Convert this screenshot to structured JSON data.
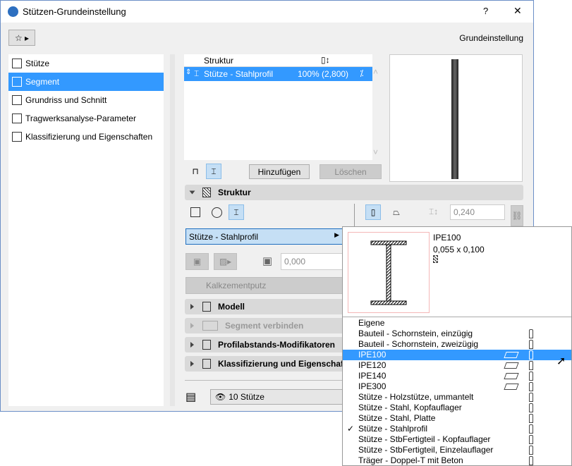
{
  "window": {
    "title": "Stützen-Grundeinstellung",
    "help": "?",
    "close": "✕",
    "preset_label": "Grundeinstellung"
  },
  "sidebar": {
    "items": [
      {
        "label": "Stütze",
        "icon": "column-icon"
      },
      {
        "label": "Segment",
        "icon": "segment-icon",
        "selected": true
      },
      {
        "label": "Grundriss und Schnitt",
        "icon": "floorplan-icon"
      },
      {
        "label": "Tragwerksanalyse-Parameter",
        "icon": "structural-analysis-icon"
      },
      {
        "label": "Klassifizierung und Eigenschaften",
        "icon": "document-icon"
      }
    ]
  },
  "segments_table": {
    "header": "Struktur",
    "header_height_icon": "height-icon",
    "row": {
      "name": "Stütze - Stahlprofil",
      "value": "100% (2,800)"
    }
  },
  "buttons": {
    "add": "Hinzufügen",
    "delete": "Löschen"
  },
  "struktur": {
    "title": "Struktur",
    "profile": "Stütze - Stahlprofil",
    "offset": "0,000",
    "material": "Kalkzementputz",
    "thickness": "0,240"
  },
  "sections": [
    {
      "label": "Modell",
      "disabled": false
    },
    {
      "label": "Segment verbinden",
      "disabled": true
    },
    {
      "label": "Profilabstands-Modifikatoren",
      "disabled": false
    },
    {
      "label": "Klassifizierung und Eigenschaften",
      "disabled": false
    }
  ],
  "layer": "10 Stütze",
  "popup": {
    "preview_name": "IPE100",
    "preview_size": "0,055 x 0,100",
    "items": [
      {
        "label": "Eigene",
        "beam": false,
        "column": false
      },
      {
        "label": "Bauteil - Schornstein, einzügig",
        "beam": false,
        "column": true
      },
      {
        "label": "Bauteil - Schornstein, zweizügig",
        "beam": false,
        "column": true
      },
      {
        "label": "IPE100",
        "beam": true,
        "column": true,
        "selected": true
      },
      {
        "label": "IPE120",
        "beam": true,
        "column": true
      },
      {
        "label": "IPE140",
        "beam": true,
        "column": true
      },
      {
        "label": "IPE300",
        "beam": true,
        "column": true
      },
      {
        "label": "Stütze - Holzstütze, ummantelt",
        "beam": false,
        "column": true
      },
      {
        "label": "Stütze - Stahl, Kopfauflager",
        "beam": false,
        "column": true
      },
      {
        "label": "Stütze - Stahl, Platte",
        "beam": false,
        "column": true
      },
      {
        "label": "Stütze - Stahlprofil",
        "beam": false,
        "column": true,
        "checked": true
      },
      {
        "label": "Stütze - StbFertigteil - Kopfauflager",
        "beam": false,
        "column": true
      },
      {
        "label": "Stütze - StbFertigteil, Einzelauflager",
        "beam": false,
        "column": true
      },
      {
        "label": "Träger - Doppel-T mit Beton",
        "beam": false,
        "column": true
      }
    ]
  },
  "colors": {
    "accent": "#3399ff",
    "toggle_on": "#c5dff5"
  }
}
